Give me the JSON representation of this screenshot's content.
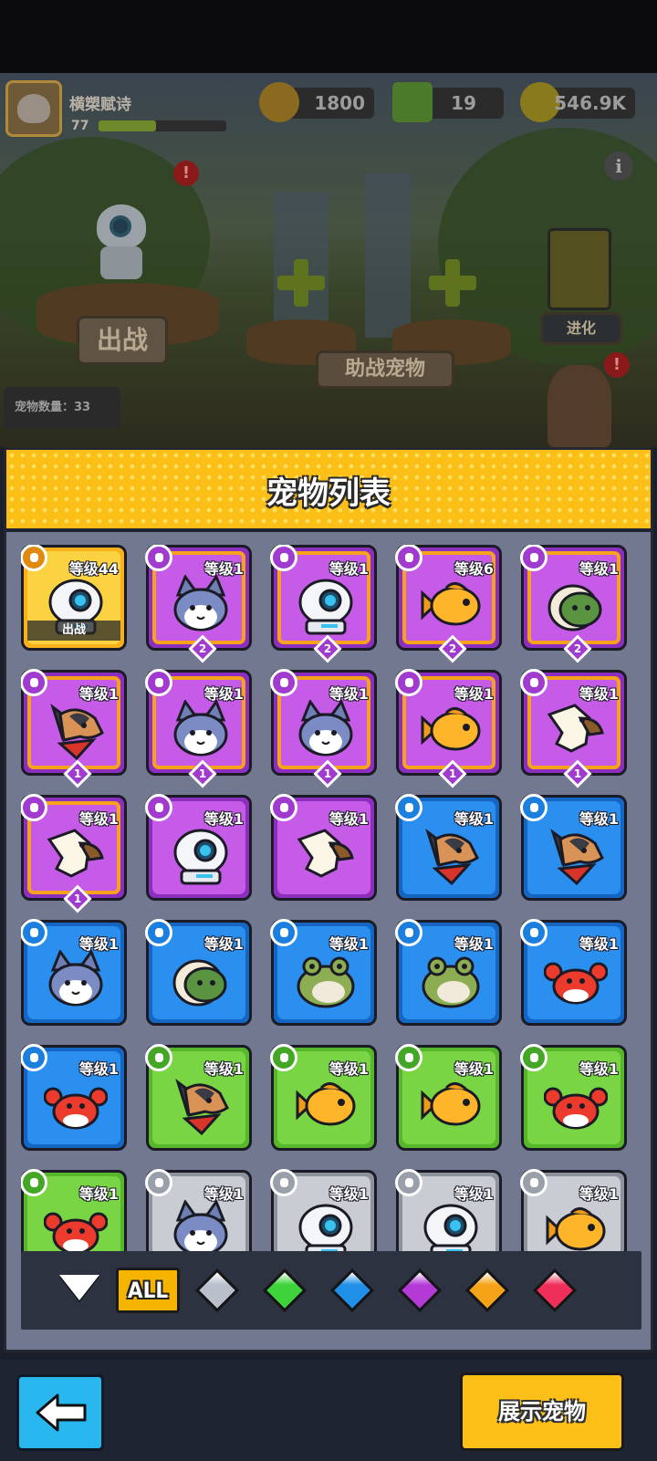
{
  "hud": {
    "player_name": "横槊赋诗",
    "player_level": "77",
    "xp_fraction": 0.45,
    "resources": [
      {
        "id": "coin",
        "value": "1800",
        "color": "#8a6a1e",
        "icon": "lion-coin-icon"
      },
      {
        "id": "gem",
        "value": "19",
        "color": "#4b7a2a",
        "icon": "green-gem-plus-icon"
      },
      {
        "id": "gold",
        "value": "546.9K",
        "color": "#8a7a1e",
        "icon": "gold-coin-plus-icon"
      }
    ],
    "info_glyph": "i",
    "alert_glyph": "!"
  },
  "scene": {
    "deploy_label": "出战",
    "assist_label": "助战宠物",
    "evolve_label": "进化",
    "pet_count_label": "宠物数量：33"
  },
  "panel": {
    "title": "宠物列表",
    "equipped_label": "出战",
    "tiles": [
      {
        "level": "等级44",
        "rarity": "gold",
        "pet": "robot",
        "badge": "dog",
        "count": null,
        "equipped": true
      },
      {
        "level": "等级1",
        "rarity": "purple",
        "pet": "husky",
        "badge": "coin",
        "count": "2"
      },
      {
        "level": "等级1",
        "rarity": "purple",
        "pet": "robot",
        "badge": "dog",
        "count": "2"
      },
      {
        "level": "等级6",
        "rarity": "purple",
        "pet": "fish",
        "badge": "turtle",
        "count": "2"
      },
      {
        "level": "等级1",
        "rarity": "purple",
        "pet": "turtle",
        "badge": "turtle",
        "count": "2"
      },
      {
        "level": "等级1",
        "rarity": "purple",
        "pet": "dog",
        "badge": "dog",
        "count": "1"
      },
      {
        "level": "等级1",
        "rarity": "purple",
        "pet": "husky",
        "badge": "coin",
        "count": "1"
      },
      {
        "level": "等级1",
        "rarity": "purple",
        "pet": "husky",
        "badge": "coin",
        "count": "1"
      },
      {
        "level": "等级1",
        "rarity": "purple",
        "pet": "fish",
        "badge": "turtle",
        "count": "1"
      },
      {
        "level": "等级1",
        "rarity": "purple",
        "pet": "eagle",
        "badge": "eagle",
        "count": "1"
      },
      {
        "level": "等级1",
        "rarity": "purple",
        "pet": "eagle",
        "badge": "eagle",
        "count": "1"
      },
      {
        "level": "等级1",
        "rarity": "purple-plain",
        "pet": "robot",
        "badge": "dog",
        "count": null
      },
      {
        "level": "等级1",
        "rarity": "purple-plain",
        "pet": "eagle",
        "badge": "eagle",
        "count": null
      },
      {
        "level": "等级1",
        "rarity": "blue",
        "pet": "dog",
        "badge": "dog",
        "count": null
      },
      {
        "level": "等级1",
        "rarity": "blue",
        "pet": "dog",
        "badge": "dog",
        "count": null
      },
      {
        "level": "等级1",
        "rarity": "blue",
        "pet": "husky",
        "badge": "coin",
        "count": null
      },
      {
        "level": "等级1",
        "rarity": "blue",
        "pet": "turtle",
        "badge": "turtle",
        "count": null
      },
      {
        "level": "等级1",
        "rarity": "blue",
        "pet": "frog",
        "badge": "coin",
        "count": null
      },
      {
        "level": "等级1",
        "rarity": "blue",
        "pet": "frog",
        "badge": "coin",
        "count": null
      },
      {
        "level": "等级1",
        "rarity": "blue",
        "pet": "crab",
        "badge": "eagle",
        "count": null
      },
      {
        "level": "等级1",
        "rarity": "blue",
        "pet": "crab",
        "badge": "eagle",
        "count": null
      },
      {
        "level": "等级1",
        "rarity": "green",
        "pet": "dog",
        "badge": "dog",
        "count": null
      },
      {
        "level": "等级1",
        "rarity": "green",
        "pet": "fish",
        "badge": "turtle",
        "count": null
      },
      {
        "level": "等级1",
        "rarity": "green",
        "pet": "fish",
        "badge": "turtle",
        "count": null
      },
      {
        "level": "等级1",
        "rarity": "green",
        "pet": "crab",
        "badge": "eagle",
        "count": null
      },
      {
        "level": "等级1",
        "rarity": "green",
        "pet": "crab",
        "badge": "eagle",
        "count": null
      },
      {
        "level": "等级1",
        "rarity": "gray",
        "pet": "husky",
        "badge": "coin",
        "count": null
      },
      {
        "level": "等级1",
        "rarity": "gray",
        "pet": "robot",
        "badge": "dog",
        "count": null
      },
      {
        "level": "等级1",
        "rarity": "gray",
        "pet": "robot",
        "badge": "dog",
        "count": null
      },
      {
        "level": "等级1",
        "rarity": "gray",
        "pet": "fish",
        "badge": "turtle",
        "count": null
      }
    ]
  },
  "filter": {
    "all_label": "ALL",
    "gems": [
      {
        "name": "gray-gem",
        "color": "#b9c0cc"
      },
      {
        "name": "green-gem",
        "color": "#3fd33b"
      },
      {
        "name": "blue-gem",
        "color": "#1f8fe8"
      },
      {
        "name": "purple-gem",
        "color": "#b43ad6"
      },
      {
        "name": "orange-gem",
        "color": "#f5a417"
      },
      {
        "name": "red-gem",
        "color": "#ef2f5a"
      }
    ]
  },
  "bottom": {
    "show_label": "展示宠物"
  },
  "colors": {
    "gold": "#f8b11a",
    "purple": "#a13bd0",
    "blue": "#1b7fe0",
    "green": "#6fd13a",
    "gray": "#a3a8b2"
  }
}
